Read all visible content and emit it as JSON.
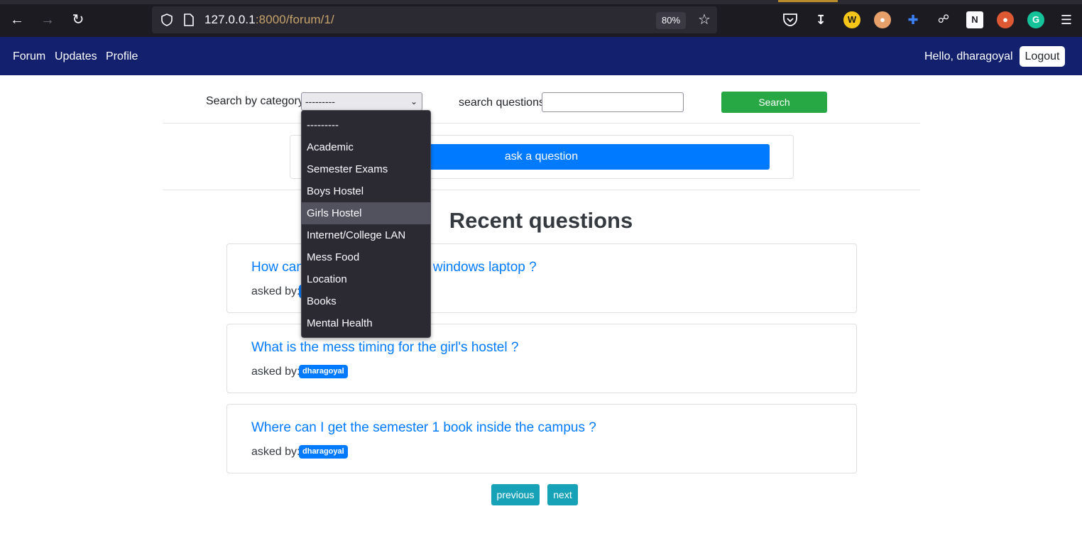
{
  "browser": {
    "url_host": "127.0.0.1",
    "url_port": ":8000",
    "url_path": "/forum/1/",
    "zoom": "80%",
    "extensions": [
      "W",
      "G"
    ]
  },
  "navbar": {
    "links": [
      "Forum",
      "Updates",
      "Profile"
    ],
    "greeting": "Hello, dharagoyal",
    "logout_label": "Logout",
    "bg_color": "#12206e"
  },
  "search": {
    "category_label": "Search by category",
    "category_selected": "---------",
    "questions_label": "search questions",
    "questions_value": "",
    "button_label": "Search"
  },
  "ask": {
    "button_label": "ask a question"
  },
  "dropdown": {
    "options": [
      "---------",
      "Academic",
      "Semester Exams",
      "Boys Hostel",
      "Girls Hostel",
      "Internet/College LAN",
      "Mess Food",
      "Location",
      "Books",
      "Mental Health"
    ],
    "highlighted": "Girls Hostel"
  },
  "recent": {
    "title": "Recent questions",
    "asked_by_label": "asked by:",
    "questions": [
      {
        "title_left": "How can",
        "title_right": "windows laptop ?",
        "author": "dharagoyal"
      },
      {
        "title": "What is the mess timing for the girl's hostel ?",
        "author": "dharagoyal"
      },
      {
        "title": "Where can I get the semester 1 book inside the campus ?",
        "author": "dharagoyal"
      }
    ]
  },
  "pagination": {
    "previous_label": "previous",
    "next_label": "next"
  }
}
